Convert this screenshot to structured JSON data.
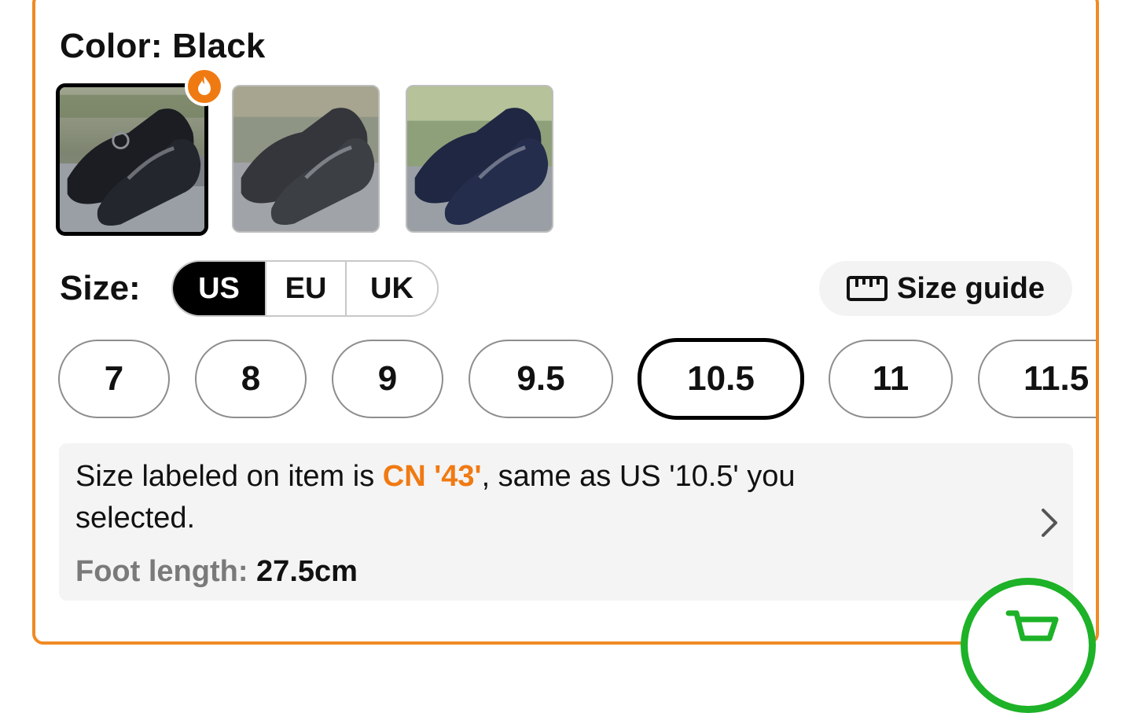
{
  "color": {
    "title": "Color: Black",
    "swatches": [
      {
        "name": "Black",
        "selected": true,
        "hot": true
      },
      {
        "name": "Gray",
        "selected": false,
        "hot": false
      },
      {
        "name": "Navy",
        "selected": false,
        "hot": false
      }
    ],
    "hot_badge_icon": "flame-icon"
  },
  "size": {
    "label": "Size:",
    "units": [
      "US",
      "EU",
      "UK"
    ],
    "active_unit": "US",
    "guide_label": "Size guide",
    "guide_icon": "ruler-icon",
    "options": [
      "7",
      "8",
      "9",
      "9.5",
      "10.5",
      "11",
      "11.5"
    ],
    "selected": "10.5"
  },
  "info": {
    "line1_prefix": "Size labeled on item is ",
    "line1_highlight": "CN '43'",
    "line1_suffix": ", same as US '10.5' you",
    "line2": "selected.",
    "foot_label": "Foot length:",
    "foot_value": "27.5cm"
  },
  "colors": {
    "accent": "#f07a12",
    "frame": "#f08a24",
    "cart": "#1db227"
  }
}
